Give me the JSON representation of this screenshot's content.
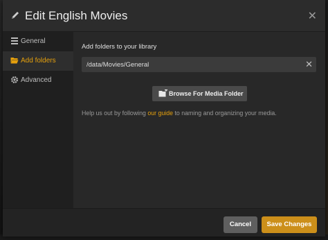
{
  "modal": {
    "title": "Edit English Movies",
    "close_glyph": "✕"
  },
  "sidebar": {
    "items": [
      {
        "label": "General",
        "icon": "library-icon"
      },
      {
        "label": "Add folders",
        "icon": "folder-icon",
        "active": true
      },
      {
        "label": "Advanced",
        "icon": "gear-icon"
      }
    ]
  },
  "content": {
    "section_label": "Add folders to your library",
    "path_value": "/data/Movies/General",
    "clear_glyph": "✕",
    "browse_label": "Browse For Media Folder",
    "help_before": "Help us out by following ",
    "help_link": "our guide",
    "help_after": " to naming and organizing your media."
  },
  "footer": {
    "cancel_label": "Cancel",
    "save_label": "Save Changes"
  },
  "colors": {
    "accent": "#e5a00d",
    "save_button": "#cc8f1a",
    "cancel_button": "#5f5f5f"
  }
}
